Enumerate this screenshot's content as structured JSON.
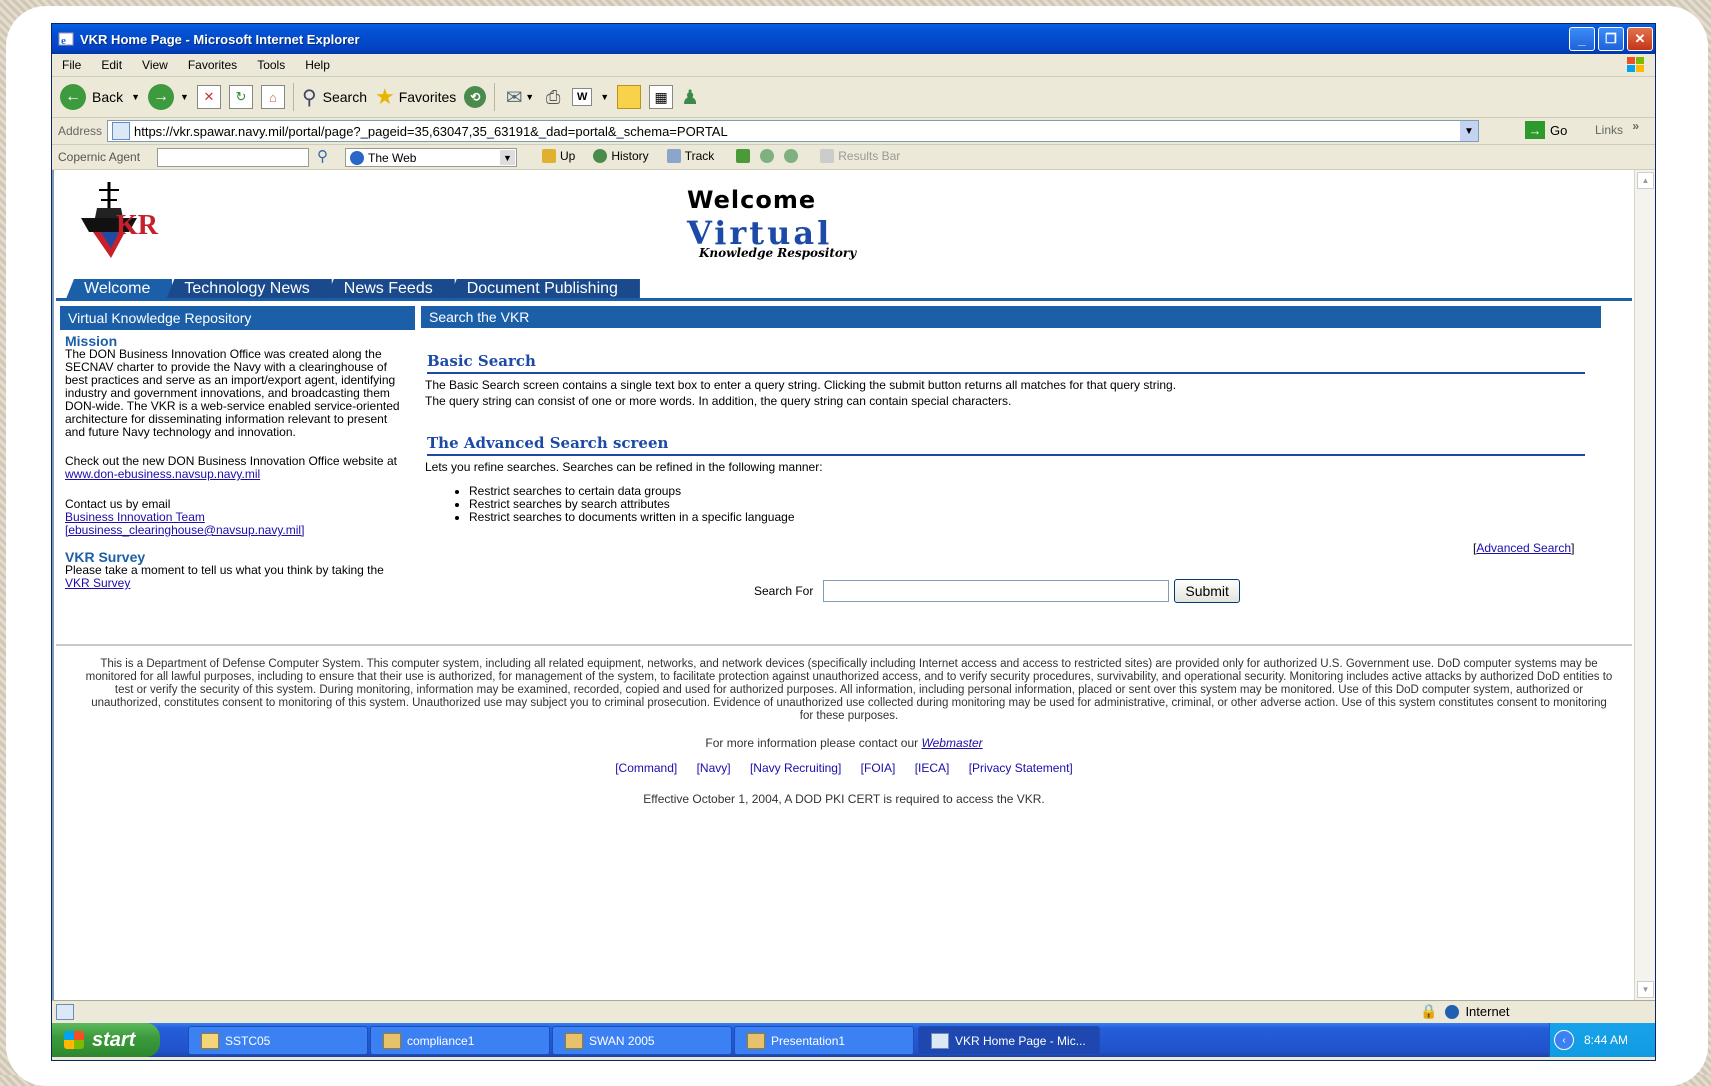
{
  "window": {
    "title": "VKR Home Page - Microsoft Internet Explorer"
  },
  "menu": [
    "File",
    "Edit",
    "View",
    "Favorites",
    "Tools",
    "Help"
  ],
  "toolbar": {
    "back": "Back",
    "search": "Search",
    "favorites": "Favorites"
  },
  "address": {
    "label": "Address",
    "url": "https://vkr.spawar.navy.mil/portal/page?_pageid=35,63047,35_63191&_dad=portal&_schema=PORTAL",
    "go": "Go",
    "links": "Links"
  },
  "copernic": {
    "label": "Copernic Agent",
    "scope": "The Web",
    "up": "Up",
    "history": "History",
    "track": "Track",
    "results_bar": "Results Bar"
  },
  "page": {
    "logo_text": "KR",
    "welcome": "Welcome",
    "brand": "Virtual",
    "brand_sub": "Knowledge Respository",
    "tabs": [
      "Welcome",
      "Technology News",
      "News Feeds",
      "Document Publishing"
    ],
    "sidebar": {
      "header": "Virtual Knowledge Repository",
      "mission_title": "Mission",
      "mission_text": "The DON Business Innovation Office was created along the SECNAV charter to provide the Navy with a clearinghouse of best practices and serve as an import/export agent, identifying industry and government innovations, and broadcasting them DON-wide. The VKR is a web-service enabled service-oriented architecture for disseminating information relevant to present and future Navy technology and innovation.",
      "checkout_text": "Check out the new DON Business Innovation Office website at",
      "website_link": "www.don-ebusiness.navsup.navy.mil",
      "contact_text": "Contact us by email",
      "team_link": "Business Innovation Team",
      "email_link": "[ebusiness_clearinghouse@navsup.navy.mil]",
      "survey_title": "VKR Survey",
      "survey_text": "Please take a moment to tell us what you think by taking the",
      "survey_link": "VKR Survey"
    },
    "main": {
      "header": "Search the VKR",
      "basic_title": "Basic Search",
      "basic_line1": "The Basic Search screen contains a single text box to enter a query string. Clicking the submit button returns all matches for that query string.",
      "basic_line2": "The query string can consist of one or more words. In addition, the query string can contain special characters.",
      "adv_title": "The Advanced Search screen",
      "adv_intro": "Lets you refine searches. Searches can be refined in the following manner:",
      "adv_items": [
        "Restrict searches to certain data groups",
        "Restrict searches by search attributes",
        "Restrict searches to documents written in a specific language"
      ],
      "adv_link": "Advanced Search",
      "search_label": "Search For",
      "search_value": "",
      "submit": "Submit"
    },
    "legal": "This is a Department of Defense Computer System. This computer system, including all related equipment, networks, and network devices (specifically including Internet access and access to restricted sites) are provided only for authorized U.S. Government use. DoD computer systems may be monitored for all lawful purposes, including to ensure that their use is authorized, for management of the system, to facilitate protection against unauthorized access, and to verify security procedures, survivability, and operational security. Monitoring includes active attacks by authorized DoD entities to test or verify the security of this system. During monitoring, information may be examined, recorded, copied and used for authorized purposes. All information, including personal information, placed or sent over this system may be monitored. Use of this DoD computer system, authorized or unauthorized, constitutes consent to monitoring of this system. Unauthorized use may subject you to criminal prosecution. Evidence of unauthorized use collected during monitoring may be used for administrative, criminal, or other adverse action. Use of this system constitutes consent to monitoring for these purposes.",
    "contact_prefix": "For more information please contact our",
    "webmaster": "Webmaster",
    "footer_links": [
      "[Command]",
      "[Navy]",
      "[Navy Recruiting]",
      "[FOIA]",
      "[IECA]",
      "[Privacy Statement]"
    ],
    "pki": "Effective October 1, 2004, A DOD PKI CERT is required to access the VKR."
  },
  "status": {
    "zone": "Internet"
  },
  "taskbar": {
    "start": "start",
    "tasks": [
      "SSTC05",
      "compliance1",
      "SWAN 2005",
      "Presentation1",
      "VKR Home Page - Mic..."
    ],
    "time": "8:44 AM"
  }
}
